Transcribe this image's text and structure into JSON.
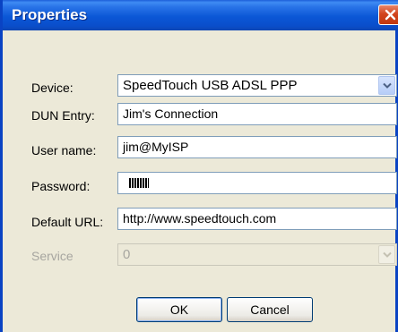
{
  "window": {
    "title": "Properties"
  },
  "form": {
    "device_label": "Device:",
    "device_value": "SpeedTouch USB ADSL PPP",
    "dun_label": "DUN Entry:",
    "dun_value": "Jim's Connection",
    "username_label": "User name:",
    "username_value": "jim@MyISP",
    "password_label": "Password:",
    "default_url_label": "Default URL:",
    "default_url_value": "http://www.speedtouch.com",
    "service_label": "Service",
    "service_value": "0"
  },
  "buttons": {
    "ok": "OK",
    "cancel": "Cancel"
  },
  "icons": {
    "close": "close-icon",
    "dropdown": "chevron-down-icon"
  },
  "colors": {
    "titlebar": "#0a4ecb",
    "dialog_bg": "#ece9d8",
    "close_button": "#d2451e",
    "field_border": "#7f9db9"
  }
}
